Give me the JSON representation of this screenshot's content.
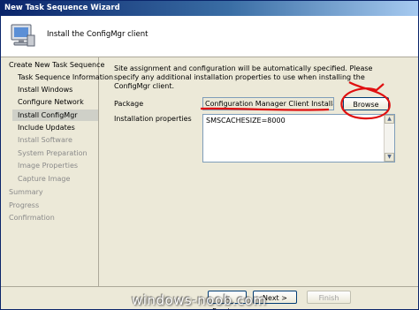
{
  "window": {
    "title": "New Task Sequence Wizard"
  },
  "header": {
    "text": "Install the ConfigMgr client",
    "icon": "computer-icon"
  },
  "sidebar": {
    "items": [
      {
        "label": "Create New Task Sequence",
        "level": 0,
        "state": "normal"
      },
      {
        "label": "Task Sequence Information",
        "level": 1,
        "state": "normal"
      },
      {
        "label": "Install Windows",
        "level": 1,
        "state": "normal"
      },
      {
        "label": "Configure Network",
        "level": 1,
        "state": "normal"
      },
      {
        "label": "Install ConfigMgr",
        "level": 1,
        "state": "selected"
      },
      {
        "label": "Include Updates",
        "level": 1,
        "state": "normal"
      },
      {
        "label": "Install Software",
        "level": 1,
        "state": "disabled"
      },
      {
        "label": "System Preparation",
        "level": 1,
        "state": "disabled"
      },
      {
        "label": "Image Properties",
        "level": 1,
        "state": "disabled"
      },
      {
        "label": "Capture Image",
        "level": 1,
        "state": "disabled"
      },
      {
        "label": "Summary",
        "level": 0,
        "state": "disabled"
      },
      {
        "label": "Progress",
        "level": 0,
        "state": "disabled"
      },
      {
        "label": "Confirmation",
        "level": 0,
        "state": "disabled"
      }
    ]
  },
  "main": {
    "description": "Site assignment and configuration will be automatically specified. Please specify any additional installation properties to use when installing the ConfigMgr client.",
    "package_label": "Package",
    "package_value": "Configuration Manager Client Installation",
    "browse_label": "Browse",
    "install_props_label": "Installation properties",
    "install_props_value": "SMSCACHESIZE=8000"
  },
  "footer": {
    "previous_label": "< Previous",
    "next_label": "Next >",
    "finish_label": "Finish"
  },
  "watermark": "windows-noob.com",
  "colors": {
    "title_bar": "#0a246a",
    "annotation_red": "#e01010"
  }
}
